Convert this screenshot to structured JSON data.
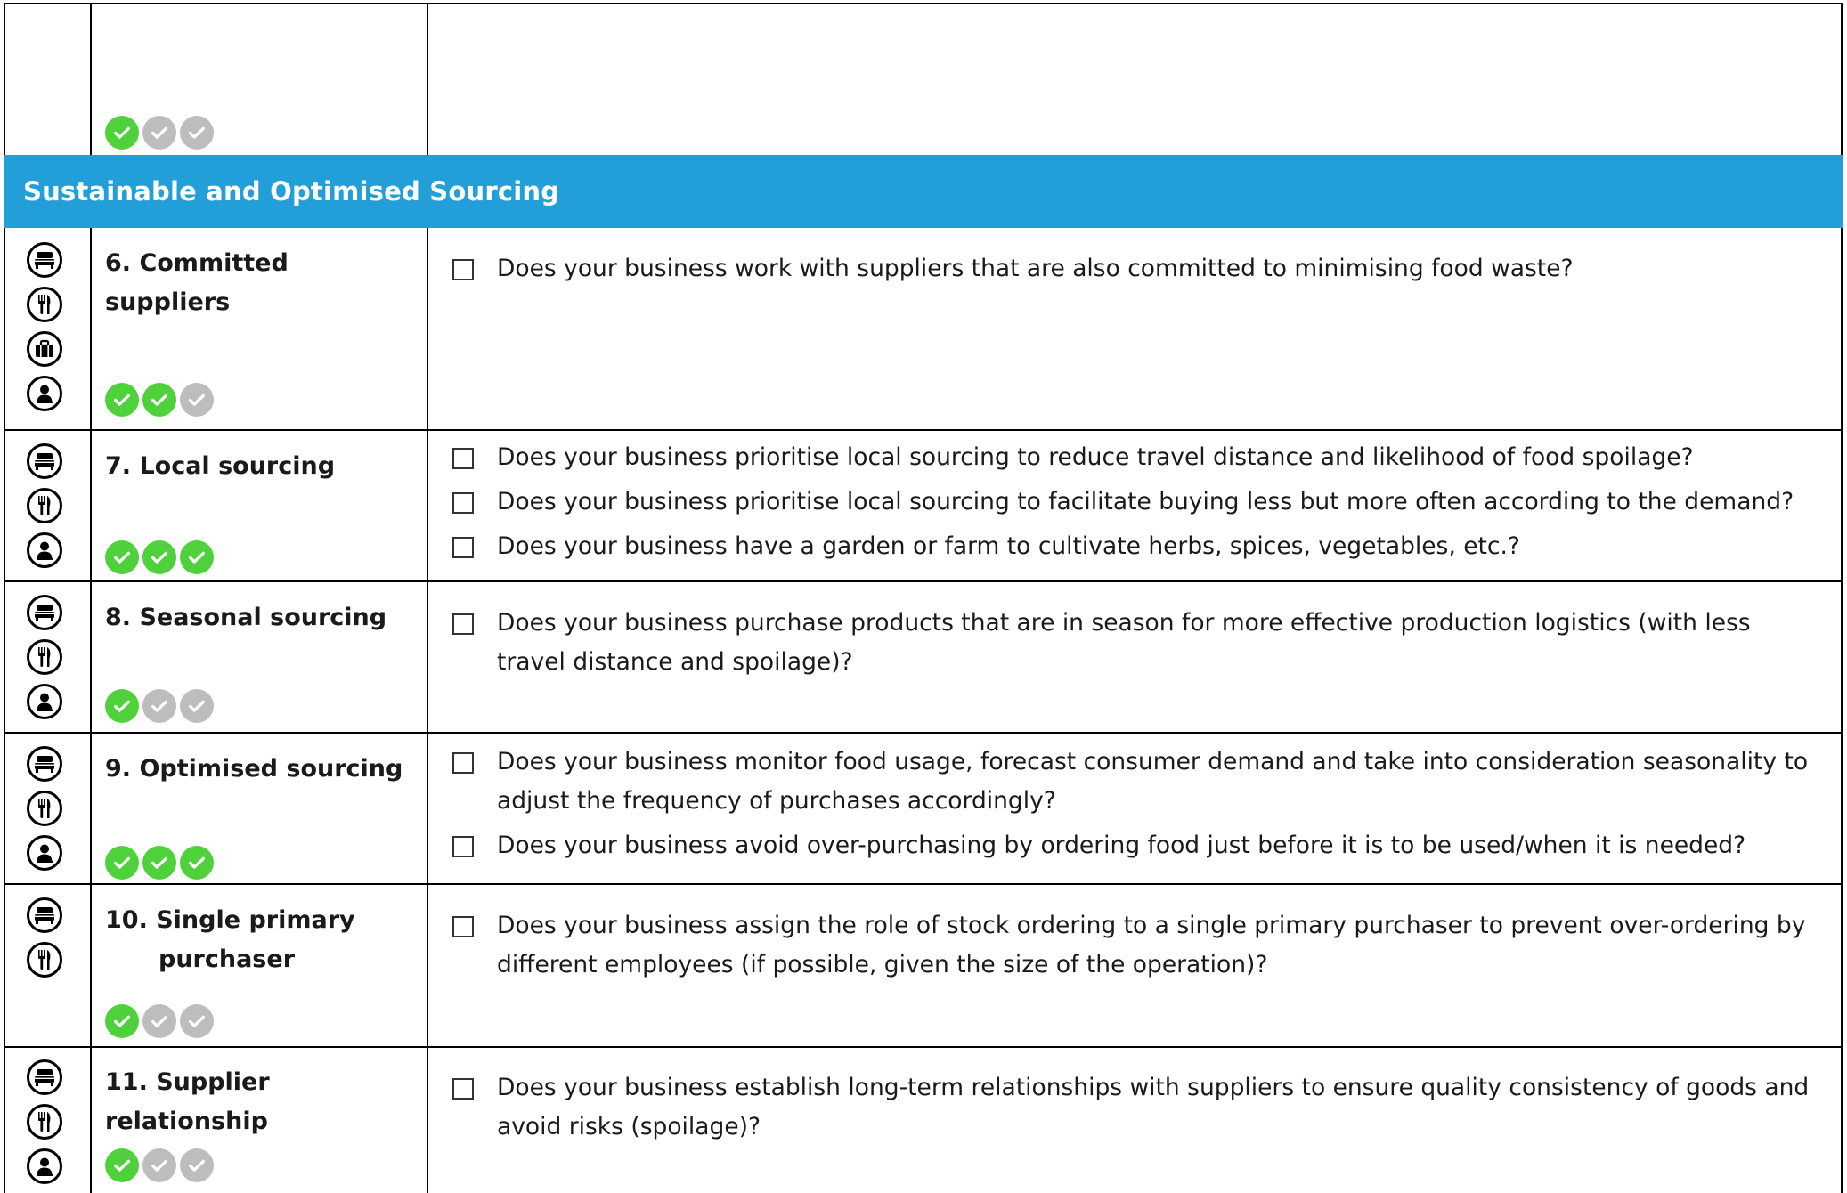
{
  "section": {
    "title": "Sustainable and Optimised Sourcing",
    "band_color": "#229ED9"
  },
  "colors": {
    "achieved": "#4FD13B",
    "not_achieved": "#BDBDBD",
    "border": "#000000"
  },
  "top_row": {
    "rating": [
      true,
      false,
      false
    ]
  },
  "rows": [
    {
      "topic": "6. Committed suppliers",
      "categories": [
        "bed-icon",
        "cutlery-icon",
        "briefcase-icon",
        "person-icon"
      ],
      "rating": [
        true,
        true,
        false
      ],
      "questions": [
        "Does your business work with suppliers that are also committed to minimising food waste?"
      ]
    },
    {
      "topic": "7. Local sourcing",
      "categories": [
        "bed-icon",
        "cutlery-icon",
        "person-icon"
      ],
      "rating": [
        true,
        true,
        true
      ],
      "questions": [
        "Does your business prioritise local sourcing to reduce travel distance and likelihood of food spoilage?",
        "Does your business prioritise local sourcing to facilitate buying less but more often according to the demand?",
        "Does your business have a garden or farm to cultivate herbs, spices, vegetables, etc.?"
      ]
    },
    {
      "topic": "8. Seasonal sourcing",
      "categories": [
        "bed-icon",
        "cutlery-icon",
        "person-icon"
      ],
      "rating": [
        true,
        false,
        false
      ],
      "questions": [
        "Does your business purchase products that are in season for more effective production logistics (with less travel distance and spoilage)?"
      ]
    },
    {
      "topic": "9. Optimised sourcing",
      "categories": [
        "bed-icon",
        "cutlery-icon",
        "person-icon"
      ],
      "rating": [
        true,
        true,
        true
      ],
      "questions": [
        "Does your business monitor food usage, forecast consumer demand and take into consideration seasonality to adjust the frequency of purchases accordingly?",
        "Does your business avoid over-purchasing by ordering food just before it is to be used/when it is needed?"
      ]
    },
    {
      "topic_line1": "10. Single primary",
      "topic_line2": "purchaser",
      "categories": [
        "bed-icon",
        "cutlery-icon"
      ],
      "rating": [
        true,
        false,
        false
      ],
      "questions": [
        "Does your business assign the role of stock ordering to a single primary purchaser to prevent over-ordering by different employees (if possible, given the size of the operation)?"
      ]
    },
    {
      "topic": "11. Supplier relationship",
      "categories": [
        "bed-icon",
        "cutlery-icon",
        "person-icon"
      ],
      "rating": [
        true,
        false,
        false
      ],
      "questions": [
        "Does your business establish long-term relationships with suppliers to ensure quality consistency of goods and avoid risks (spoilage)?"
      ]
    }
  ]
}
